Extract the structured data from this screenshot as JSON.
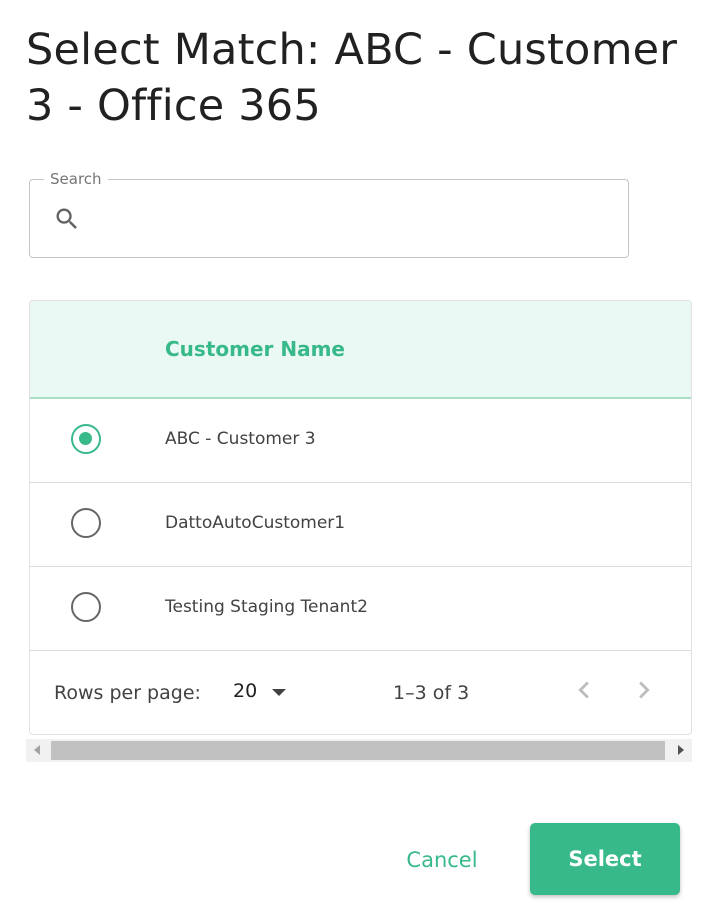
{
  "dialog": {
    "title": "Select Match: ABC - Customer 3 - Office 365"
  },
  "search": {
    "label": "Search",
    "value": "",
    "placeholder": "",
    "icon": "search-icon"
  },
  "table": {
    "columns": [
      "Customer Name"
    ],
    "rows": [
      {
        "name": "ABC - Customer 3",
        "selected": true
      },
      {
        "name": "DattoAutoCustomer1",
        "selected": false
      },
      {
        "name": "Testing Staging Tenant2",
        "selected": false
      }
    ]
  },
  "pagination": {
    "rows_per_page_label": "Rows per page:",
    "rows_per_page_value": "20",
    "range_label": "1–3 of 3",
    "prev_icon": "chevron-left-icon",
    "next_icon": "chevron-right-icon"
  },
  "actions": {
    "cancel_label": "Cancel",
    "select_label": "Select"
  },
  "colors": {
    "accent": "#38b98a",
    "header_bg": "#eaf9f3",
    "text": "#212121"
  }
}
